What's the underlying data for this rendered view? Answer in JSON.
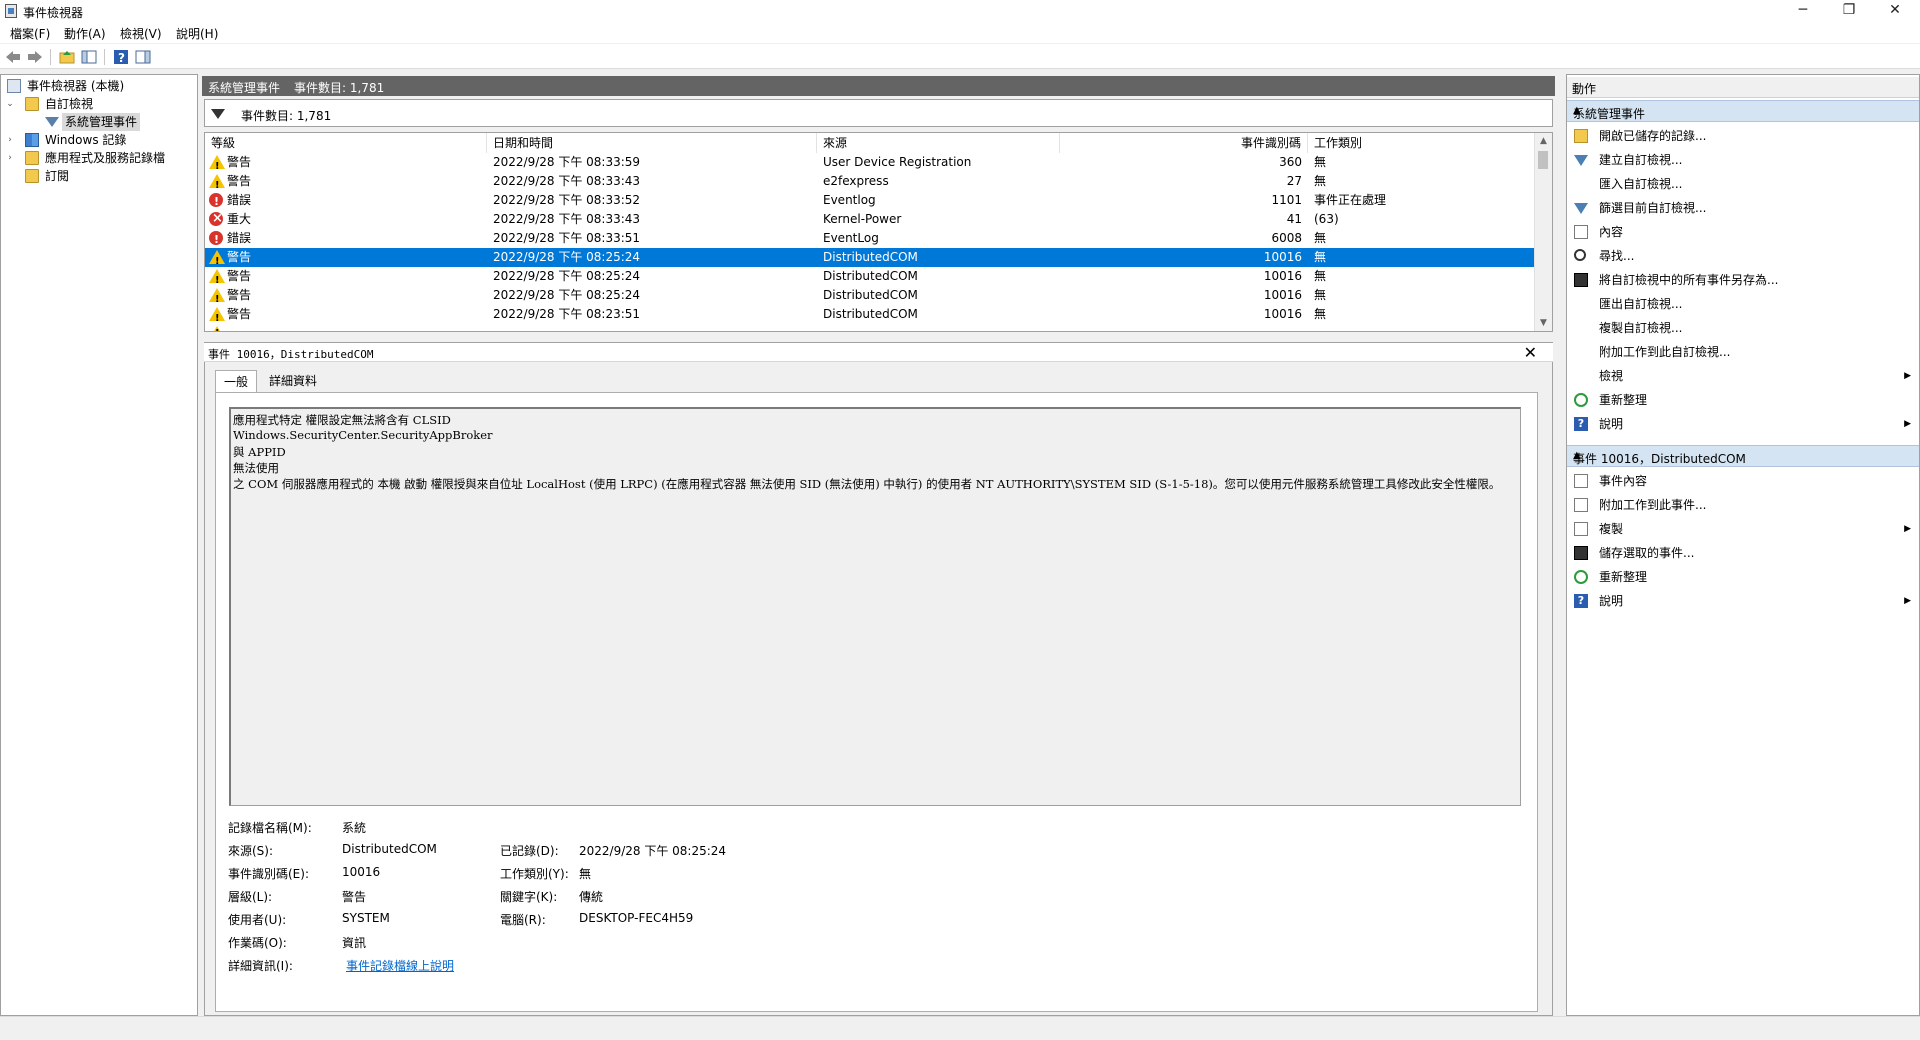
{
  "window": {
    "title": "事件檢視器",
    "minimize_glyph": "─",
    "restore_glyph": "❐",
    "close_glyph": "✕"
  },
  "menu": [
    "檔案(F)",
    "動作(A)",
    "檢視(V)",
    "說明(H)"
  ],
  "tree": {
    "root": "事件檢視器 (本機)",
    "custom_views": "自訂檢視",
    "admin_events": "系統管理事件",
    "windows_logs": "Windows 記錄",
    "app_logs": "應用程式及服務記錄檔",
    "subscriptions": "訂閱"
  },
  "center": {
    "header_title": "系統管理事件",
    "header_count": "事件數目: 1,781",
    "filter_text": "事件數目: 1,781",
    "columns": [
      "等級",
      "日期和時間",
      "來源",
      "事件識別碼",
      "工作類別"
    ],
    "rows": [
      {
        "level": "警告",
        "icon": "warning-icon",
        "datetime": "2022/9/28 下午 08:33:59",
        "source": "User Device Registration",
        "id": "360",
        "task": "無"
      },
      {
        "level": "警告",
        "icon": "warning-icon",
        "datetime": "2022/9/28 下午 08:33:43",
        "source": "e2fexpress",
        "id": "27",
        "task": "無"
      },
      {
        "level": "錯誤",
        "icon": "error-icon",
        "datetime": "2022/9/28 下午 08:33:52",
        "source": "Eventlog",
        "id": "1101",
        "task": "事件正在處理"
      },
      {
        "level": "重大",
        "icon": "critical-icon",
        "datetime": "2022/9/28 下午 08:33:43",
        "source": "Kernel-Power",
        "id": "41",
        "task": "(63)"
      },
      {
        "level": "錯誤",
        "icon": "error-icon",
        "datetime": "2022/9/28 下午 08:33:51",
        "source": "EventLog",
        "id": "6008",
        "task": "無"
      },
      {
        "level": "警告",
        "icon": "warning-icon",
        "datetime": "2022/9/28 下午 08:25:24",
        "source": "DistributedCOM",
        "id": "10016",
        "task": "無",
        "selected": true
      },
      {
        "level": "警告",
        "icon": "warning-icon",
        "datetime": "2022/9/28 下午 08:25:24",
        "source": "DistributedCOM",
        "id": "10016",
        "task": "無"
      },
      {
        "level": "警告",
        "icon": "warning-icon",
        "datetime": "2022/9/28 下午 08:25:24",
        "source": "DistributedCOM",
        "id": "10016",
        "task": "無"
      },
      {
        "level": "警告",
        "icon": "warning-icon",
        "datetime": "2022/9/28 下午 08:23:51",
        "source": "DistributedCOM",
        "id": "10016",
        "task": "無"
      }
    ]
  },
  "detail": {
    "title": "事件 10016，DistributedCOM",
    "close_glyph": "✕",
    "tabs": [
      "一般",
      "詳細資料"
    ],
    "message_lines": [
      "應用程式特定 權限設定無法將含有 CLSID",
      "Windows.SecurityCenter.SecurityAppBroker",
      "與 APPID",
      "無法使用",
      " 之 COM 伺服器應用程式的 本機 啟動 權限授與來自位址 LocalHost (使用 LRPC) (在應用程式容器 無法使用 SID (無法使用) 中執行) 的使用者 NT AUTHORITY\\SYSTEM SID (S-1-5-18)。您可以使用元件服務系統管理工具修改此安全性權限。"
    ],
    "props": {
      "log_name_label": "記錄檔名稱(M):",
      "log_name": "系統",
      "source_label": "來源(S):",
      "source": "DistributedCOM",
      "logged_label": "已記錄(D):",
      "logged": "2022/9/28 下午 08:25:24",
      "event_id_label": "事件識別碼(E):",
      "event_id": "10016",
      "task_label": "工作類別(Y):",
      "task": "無",
      "level_label": "層級(L):",
      "level": "警告",
      "keywords_label": "關鍵字(K):",
      "keywords": "傳統",
      "user_label": "使用者(U):",
      "user": "SYSTEM",
      "computer_label": "電腦(R):",
      "computer": "DESKTOP-FEC4H59",
      "opcode_label": "作業碼(O):",
      "opcode": "資訊",
      "more_info_label": "詳細資訊(I):",
      "more_info_link": "事件記錄檔線上說明"
    }
  },
  "actions": {
    "header": "動作",
    "section1": "系統管理事件",
    "section1_items": [
      {
        "label": "開啟已儲存的記錄...",
        "icon": "open-folder-icon"
      },
      {
        "label": "建立自訂檢視...",
        "icon": "filter-icon"
      },
      {
        "label": "匯入自訂檢視...",
        "icon": ""
      },
      {
        "label": "篩選目前自訂檢視...",
        "icon": "filter-icon"
      },
      {
        "label": "內容",
        "icon": "properties-icon"
      },
      {
        "label": "尋找...",
        "icon": "find-icon"
      },
      {
        "label": "將自訂檢視中的所有事件另存為...",
        "icon": "save-icon"
      },
      {
        "label": "匯出自訂檢視...",
        "icon": ""
      },
      {
        "label": "複製自訂檢視...",
        "icon": ""
      },
      {
        "label": "附加工作到此自訂檢視...",
        "icon": ""
      },
      {
        "label": "檢視",
        "icon": "",
        "submenu": true
      },
      {
        "label": "重新整理",
        "icon": "refresh-icon"
      },
      {
        "label": "說明",
        "icon": "help-icon",
        "submenu": true
      }
    ],
    "section2": "事件 10016，DistributedCOM",
    "section2_items": [
      {
        "label": "事件內容",
        "icon": "properties-icon"
      },
      {
        "label": "附加工作到此事件...",
        "icon": "task-icon"
      },
      {
        "label": "複製",
        "icon": "copy-icon",
        "submenu": true
      },
      {
        "label": "儲存選取的事件...",
        "icon": "save-icon"
      },
      {
        "label": "重新整理",
        "icon": "refresh-icon"
      },
      {
        "label": "說明",
        "icon": "help-icon",
        "submenu": true
      }
    ],
    "submenu_glyph": "▶",
    "collapse_glyph": "▲"
  },
  "colors": {
    "selection": "#0078d7",
    "header_gray": "#646464",
    "section_blue": "#d5e4f2"
  }
}
